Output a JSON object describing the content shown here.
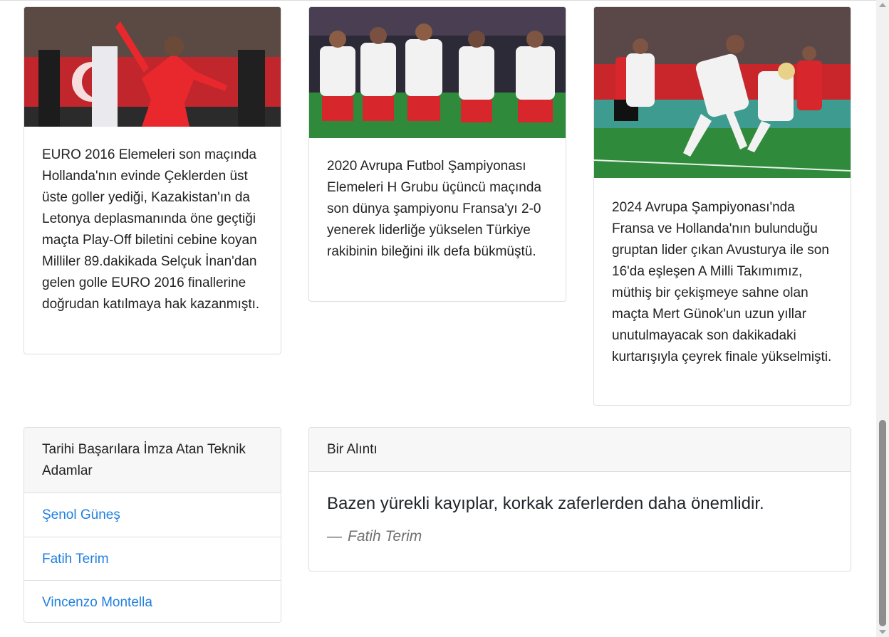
{
  "cards": [
    {
      "image_alt": "EURO 2016 Elemeleri gol sevinci",
      "text": "EURO 2016 Elemeleri son maçında Hollanda'nın evinde Çeklerden üst üste goller yediği, Kazakistan'ın da Letonya deplasmanında öne geçtiği maçta Play-Off biletini cebine koyan Milliler 89.dakikada Selçuk İnan'dan gelen golle EURO 2016 finallerine doğrudan katılmaya hak kazanmıştı."
    },
    {
      "image_alt": "Fransa maçı asker selamı",
      "text": "2020 Avrupa Futbol Şampiyonası Elemeleri H Grubu üçüncü maçında son dünya şampiyonu Fransa'yı 2-0 yenerek liderliğe yükselen Türkiye rakibinin bileğini ilk defa bükmüştü."
    },
    {
      "image_alt": "Avusturya maçı gol sevinci",
      "text": "2024 Avrupa Şampiyonası'nda Fransa ve Hollanda'nın bulunduğu gruptan lider çıkan Avusturya ile son 16'da eşleşen A Milli Takımımız, müthiş bir çekişmeye sahne olan maçta Mert Günok'un uzun yıllar unutulmayacak son dakikadaki kurtarışıyla çeyrek finale yükselmişti."
    }
  ],
  "coaches": {
    "title": "Tarihi Başarılara İmza Atan Teknik Adamlar",
    "items": [
      "Şenol Güneş",
      "Fatih Terim",
      "Vincenzo Montella"
    ]
  },
  "quote": {
    "header": "Bir Alıntı",
    "text": "Bazen yürekli kayıplar, korkak zaferlerden daha önemlidir.",
    "dash": "—",
    "author": "Fatih Terim"
  },
  "colors": {
    "link": "#1f7fe0",
    "jersey_red": "#d8262d",
    "jersey_white": "#f2f2f2",
    "pitch_green": "#2f8a3c"
  }
}
